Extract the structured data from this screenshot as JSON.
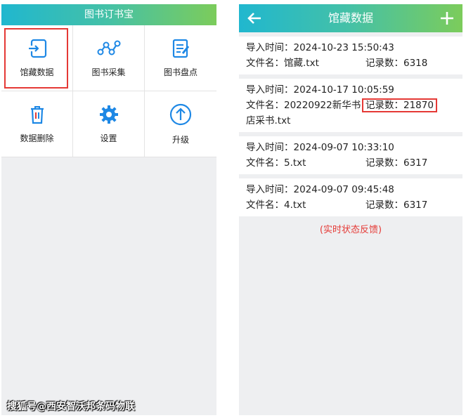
{
  "left": {
    "title": "图书订书宝",
    "tiles": [
      {
        "label": "馆藏数据",
        "icon": "import-icon"
      },
      {
        "label": "图书采集",
        "icon": "chart-nodes-icon"
      },
      {
        "label": "图书盘点",
        "icon": "clipboard-icon"
      },
      {
        "label": "数据删除",
        "icon": "trash-icon"
      },
      {
        "label": "设置",
        "icon": "gear-icon"
      },
      {
        "label": "升级",
        "icon": "upgrade-icon"
      }
    ]
  },
  "right": {
    "title": "馆藏数据",
    "records": [
      {
        "time_label": "导入时间：",
        "time": "2024-10-23 15:50:43",
        "file_label": "文件名：",
        "file": "馆藏.txt",
        "count_label": "记录数：",
        "count": "6318"
      },
      {
        "time_label": "导入时间：",
        "time": "2024-10-17 10:05:59",
        "file_label": "文件名：",
        "file": "20220922新华书店采书.txt",
        "count_label": "记录数：",
        "count": "21870"
      },
      {
        "time_label": "导入时间：",
        "time": "2024-09-07 10:33:10",
        "file_label": "文件名：",
        "file": "5.txt",
        "count_label": "记录数：",
        "count": "6317"
      },
      {
        "time_label": "导入时间：",
        "time": "2024-09-07 09:45:48",
        "file_label": "文件名：",
        "file": "4.txt",
        "count_label": "记录数：",
        "count": "6317"
      }
    ],
    "status": "(实时状态反馈)"
  },
  "watermark": "搜狐号@西安智沃邦条码物联",
  "colors": {
    "accent_start": "#20b7cf",
    "accent_end": "#7ccc5b",
    "icon": "#1e88e5",
    "highlight": "#e53935"
  }
}
